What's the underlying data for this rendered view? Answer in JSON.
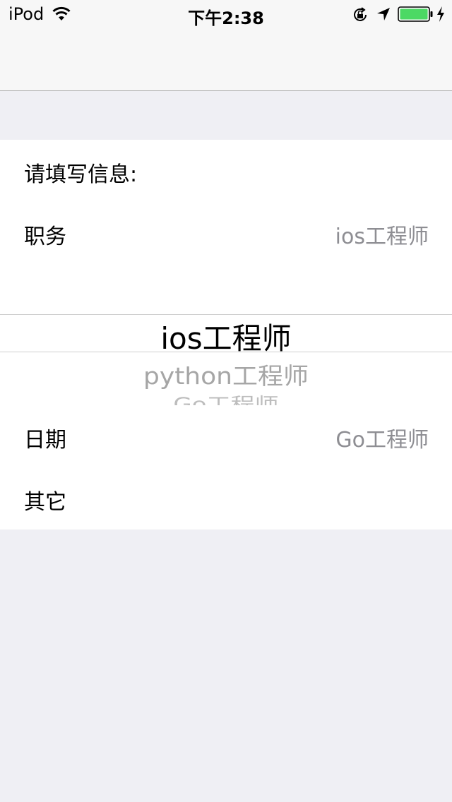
{
  "status_bar": {
    "device": "iPod",
    "time": "下午2:38",
    "icons": [
      "wifi-icon",
      "orientation-lock-icon",
      "location-arrow-icon",
      "battery-icon",
      "charging-bolt-icon"
    ],
    "battery_color": "#4cd964"
  },
  "form": {
    "header": "请填写信息:",
    "rows": [
      {
        "label": "职务",
        "value": "ios工程师"
      },
      {
        "label": "日期",
        "value": "Go工程师"
      },
      {
        "label": "其它",
        "value": ""
      }
    ]
  },
  "picker": {
    "items": [
      "ios工程师",
      "python工程师",
      "Go工程师"
    ],
    "selected_index": 0
  }
}
